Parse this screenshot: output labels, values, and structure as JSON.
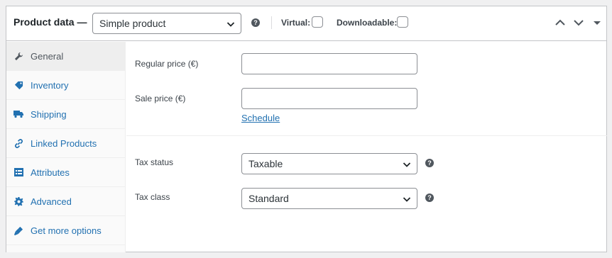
{
  "header": {
    "title": "Product data —",
    "product_type": "Simple product",
    "help_glyph": "?",
    "virtual_label": "Virtual:",
    "virtual_checked": false,
    "downloadable_label": "Downloadable:",
    "downloadable_checked": false
  },
  "tabs": [
    {
      "label": "General",
      "icon": "wrench-icon",
      "active": true
    },
    {
      "label": "Inventory",
      "icon": "tag-icon",
      "active": false
    },
    {
      "label": "Shipping",
      "icon": "truck-icon",
      "active": false
    },
    {
      "label": "Linked Products",
      "icon": "link-icon",
      "active": false
    },
    {
      "label": "Attributes",
      "icon": "list-icon",
      "active": false
    },
    {
      "label": "Advanced",
      "icon": "gear-icon",
      "active": false
    },
    {
      "label": "Get more options",
      "icon": "plugin-icon",
      "active": false
    }
  ],
  "general": {
    "regular_price_label": "Regular price (€)",
    "regular_price_value": "",
    "sale_price_label": "Sale price (€)",
    "sale_price_value": "",
    "schedule_link": "Schedule",
    "tax_status_label": "Tax status",
    "tax_status_value": "Taxable",
    "tax_class_label": "Tax class",
    "tax_class_value": "Standard"
  },
  "colors": {
    "link": "#2271b1",
    "border": "#c3c4c7",
    "active_tab_bg": "#eeeeee"
  }
}
